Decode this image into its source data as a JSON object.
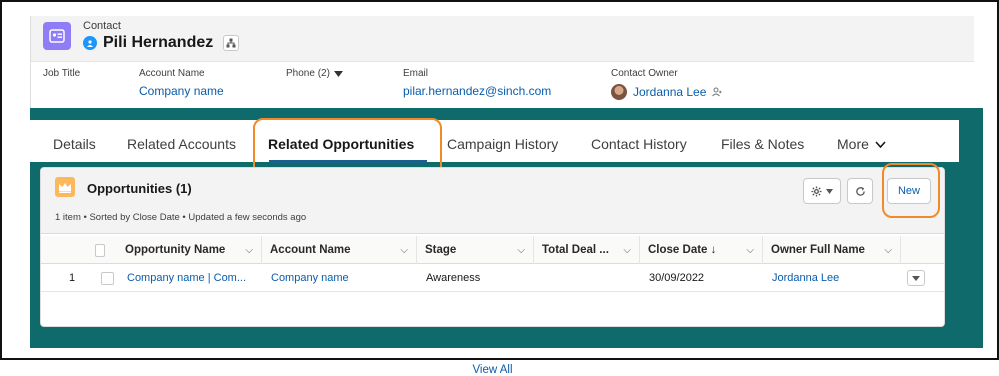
{
  "record": {
    "object_label": "Contact",
    "name": "Pili Hernandez",
    "fields": [
      {
        "label": "Job Title",
        "value": ""
      },
      {
        "label": "Account Name",
        "value": "Company name"
      },
      {
        "label": "Phone (2)",
        "value": ""
      },
      {
        "label": "Email",
        "value": "pilar.hernandez@sinch.com"
      },
      {
        "label": "Contact Owner",
        "value": "Jordanna Lee"
      }
    ]
  },
  "tabs": [
    {
      "label": "Details"
    },
    {
      "label": "Related Accounts"
    },
    {
      "label": "Related Opportunities"
    },
    {
      "label": "Campaign History"
    },
    {
      "label": "Contact History"
    },
    {
      "label": "Files & Notes"
    },
    {
      "label": "More"
    }
  ],
  "active_tab": "Related Opportunities",
  "related_list": {
    "title": "Opportunities (1)",
    "meta": "1 item • Sorted by Close Date • Updated a few seconds ago",
    "new_label": "New",
    "columns": [
      "Opportunity Name",
      "Account Name",
      "Stage",
      "Total Deal ...",
      "Close Date ↓",
      "Owner Full Name"
    ],
    "rows": [
      {
        "num": "1",
        "opportunity": "Company name | Com...",
        "account": "Company name",
        "stage": "Awareness",
        "total": "",
        "close_date": "30/09/2022",
        "owner": "Jordanna Lee"
      }
    ],
    "view_all": "View All"
  },
  "icons": [
    "contact-card-icon",
    "status-dot-icon",
    "hierarchy-icon",
    "dropdown-caret-icon",
    "owner-change-icon",
    "crown-icon",
    "gear-icon",
    "refresh-icon",
    "chevron-down-icon",
    "row-action-icon"
  ],
  "colors": {
    "teal": "#0f6b6b",
    "highlight": "#f08a2a",
    "link": "#0b5cab",
    "record_icon": "#8f7cf7",
    "list_icon": "#fcb95b"
  }
}
